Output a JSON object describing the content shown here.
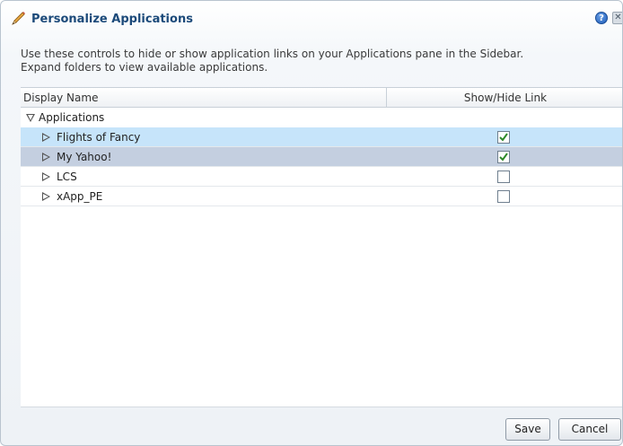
{
  "dialog": {
    "title": "Personalize Applications",
    "help_label": "?",
    "close_label": "✕",
    "instructions_line1": "Use these controls to hide or show application links on your Applications pane in the Sidebar.",
    "instructions_line2": "Expand folders to view available applications."
  },
  "table": {
    "columns": [
      "Display Name",
      "Show/Hide Link"
    ],
    "root": {
      "label": "Applications",
      "expanded": true
    },
    "rows": [
      {
        "label": "Flights of Fancy",
        "checked": true,
        "state": "selected"
      },
      {
        "label": "My Yahoo!",
        "checked": true,
        "state": "hover"
      },
      {
        "label": "LCS",
        "checked": false,
        "state": "normal"
      },
      {
        "label": "xApp_PE",
        "checked": false,
        "state": "normal"
      }
    ]
  },
  "buttons": {
    "save": "Save",
    "cancel": "Cancel"
  },
  "colors": {
    "title": "#1c4a7a",
    "selected_row": "#c6e4fa",
    "hover_row": "#c4cfe0",
    "check_mark": "#2f8a2a"
  },
  "icons": {
    "title": "pencil-icon",
    "help": "help-icon",
    "close": "close-icon",
    "collapsed": "triangle-right-icon",
    "expanded": "triangle-down-icon"
  }
}
